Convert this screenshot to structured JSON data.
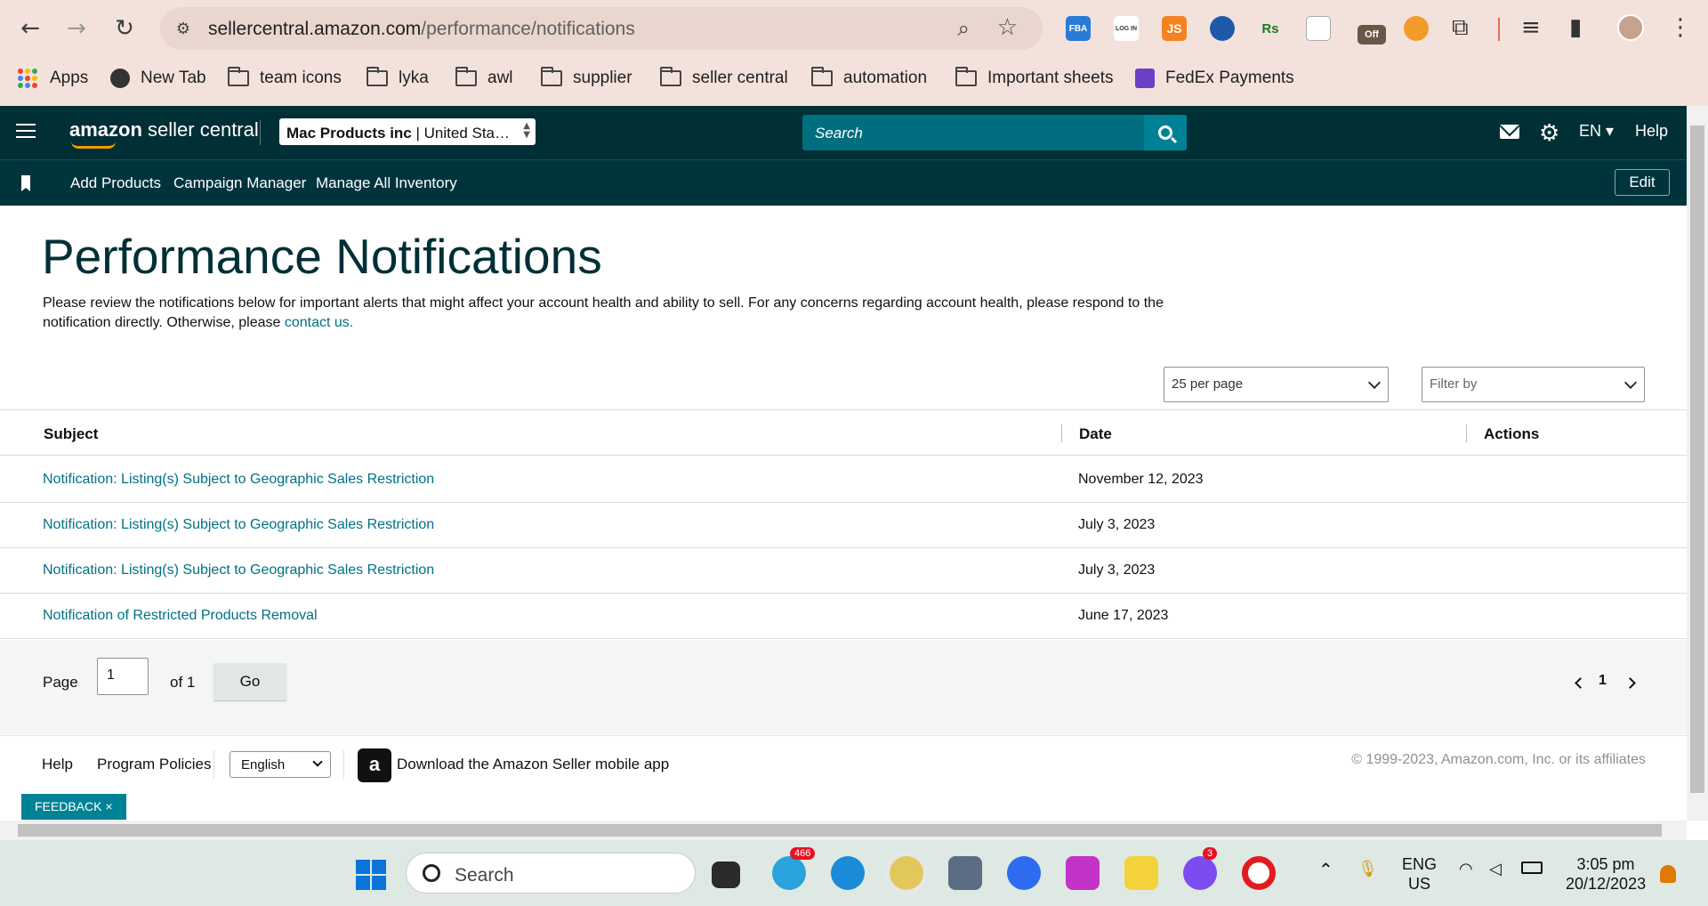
{
  "browser": {
    "url_host": "sellercentral.amazon.com",
    "url_path": "/performance/notifications",
    "bookmarks": [
      "Apps",
      "New Tab",
      "team icons",
      "lyka",
      "awl",
      "supplier",
      "seller central",
      "automation",
      "Important sheets",
      "FedEx Payments"
    ],
    "extensions": [
      "FBA",
      "LOG IN",
      "JS",
      "Rs",
      "Off"
    ]
  },
  "header": {
    "logo_bold": "amazon",
    "logo_rest": " seller central",
    "account_name": "Mac Products inc",
    "account_market": " | United Sta…",
    "search_placeholder": "Search",
    "language": "EN",
    "help": "Help"
  },
  "nav": {
    "links": [
      "Add Products",
      "Campaign Manager",
      "Manage All Inventory"
    ],
    "edit": "Edit"
  },
  "page": {
    "title": "Performance Notifications",
    "intro": "Please review the notifications below for important alerts that might affect your account health and ability to sell. For any concerns regarding account health, please respond to the notification directly. Otherwise, please ",
    "intro_link": "contact us.",
    "per_page": "25 per page",
    "filter_placeholder": "Filter by"
  },
  "table": {
    "headers": {
      "subject": "Subject",
      "date": "Date",
      "actions": "Actions"
    },
    "rows": [
      {
        "subject": "Notification: Listing(s) Subject to Geographic Sales Restriction",
        "date": "November 12, 2023"
      },
      {
        "subject": "Notification: Listing(s) Subject to Geographic Sales Restriction",
        "date": "July 3, 2023"
      },
      {
        "subject": "Notification: Listing(s) Subject to Geographic Sales Restriction",
        "date": "July 3, 2023"
      },
      {
        "subject": "Notification of Restricted Products Removal",
        "date": "June 17, 2023"
      }
    ]
  },
  "pager": {
    "page_label": "Page",
    "page_value": "1",
    "of_label": "of 1",
    "go": "Go",
    "current": "1"
  },
  "footer": {
    "help": "Help",
    "policies": "Program Policies",
    "language": "English",
    "app_text": "Download the Amazon Seller mobile app",
    "copyright": "© 1999-2023, Amazon.com, Inc. or its affiliates",
    "feedback": "FEEDBACK ×"
  },
  "taskbar": {
    "search": "Search",
    "telegram_badge": "466",
    "messenger_badge": "3",
    "lang_top": "ENG",
    "lang_bottom": "US",
    "time": "3:05 pm",
    "date": "20/12/2023"
  },
  "colors": {
    "header_bg": "#002f36",
    "link": "#007185",
    "accent_teal": "#008296",
    "chrome_bg": "#f3e2dc"
  }
}
